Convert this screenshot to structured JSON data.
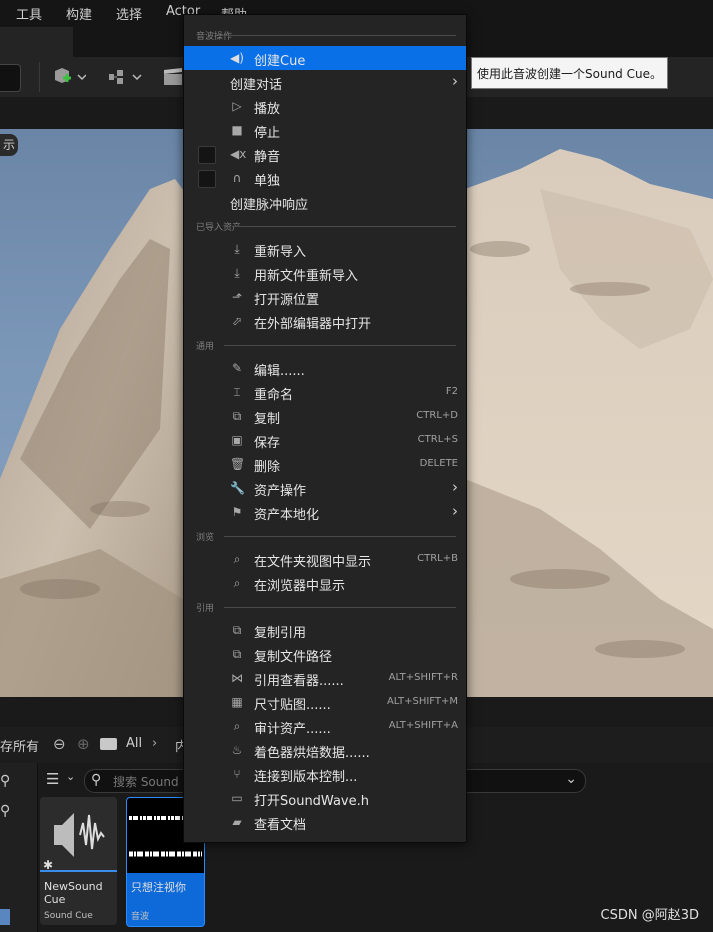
{
  "menubar": {
    "items": [
      "工具",
      "构建",
      "选择",
      "Actor",
      "帮助"
    ]
  },
  "viewport": {
    "label": "示"
  },
  "content_browser": {
    "save_all": "存所有",
    "path_all": "All",
    "path_next": "内",
    "search_placeholder": "搜索 Sound",
    "assets": [
      {
        "name": "NewSound Cue",
        "type": "Sound Cue"
      },
      {
        "name": "只想注视你",
        "type": "音波"
      }
    ]
  },
  "context_menu": {
    "sections": {
      "sound_wave_actions": "音波操作",
      "imported_asset": "已导入资产",
      "common": "通用",
      "browse": "浏览",
      "references": "引用"
    },
    "items": {
      "create_cue": "创建Cue",
      "create_dialogue": "创建对话",
      "play": "播放",
      "stop": "停止",
      "mute": "静音",
      "solo": "单独",
      "create_impulse": "创建脉冲响应",
      "reimport": "重新导入",
      "reimport_new_file": "用新文件重新导入",
      "open_source_location": "打开源位置",
      "open_external_editor": "在外部编辑器中打开",
      "edit": "编辑......",
      "rename": "重命名",
      "duplicate": "复制",
      "save": "保存",
      "delete": "删除",
      "asset_actions": "资产操作",
      "asset_localization": "资产本地化",
      "show_in_folder": "在文件夹视图中显示",
      "show_in_browser": "在浏览器中显示",
      "copy_reference": "复制引用",
      "copy_file_path": "复制文件路径",
      "reference_viewer": "引用查看器......",
      "size_map": "尺寸贴图......",
      "audit_assets": "审计资产......",
      "shader_cook_stats": "着色器烘焙数据......",
      "connect_source_control": "连接到版本控制...",
      "open_header": "打开SoundWave.h",
      "view_docs": "查看文档"
    },
    "shortcuts": {
      "rename": "F2",
      "duplicate": "CTRL+D",
      "save": "CTRL+S",
      "delete": "DELETE",
      "show_in_folder": "CTRL+B",
      "reference_viewer": "ALT+SHIFT+R",
      "size_map": "ALT+SHIFT+M",
      "audit_assets": "ALT+SHIFT+A"
    }
  },
  "tooltip": "使用此音波创建一个Sound Cue。",
  "watermark": "CSDN @阿赵3D",
  "colors": {
    "highlight": "#0a70e8",
    "menu_bg": "#242424",
    "selected_tile": "#0e6ad8"
  }
}
